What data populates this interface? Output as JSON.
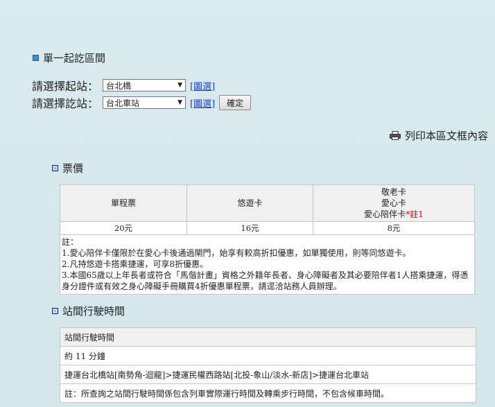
{
  "section1": {
    "title": "單一起訖區間"
  },
  "form": {
    "start_label": "請選擇起站：",
    "start_value": "台北橋",
    "end_label": "請選擇訖站：",
    "end_value": "台北車站",
    "map_select_label": "[圖選]",
    "confirm_label": "確定"
  },
  "print_label": "列印本區文框內容",
  "fare": {
    "title": "票價",
    "headers": {
      "single": "單程票",
      "easycard": "悠遊卡",
      "senior_1": "敬老卡",
      "senior_2": "愛心卡",
      "senior_3": "愛心陪伴卡",
      "senior_note": "*註1"
    },
    "values": {
      "single": "20元",
      "easycard": "16元",
      "senior": "8元"
    },
    "notes": [
      "註：",
      "1.愛心陪伴卡僅限於在愛心卡後通過閘門，始享有較高折扣優惠，如單獨使用，則等同悠遊卡。",
      "2.凡持悠遊卡搭乘捷運，可享8折優惠。",
      "3.本國65歲以上年長者或符合「馬偕計畫」資格之外籍年長者、身心障礙者及其必要陪伴者1人搭乘捷運，得憑身分證件或有效之身心障礙手冊購買4折優惠單程票，請逕洽站務人員辦理。"
    ]
  },
  "travel": {
    "title": "站間行駛時間",
    "header": "站間行駛時間",
    "duration": "約 11 分鐘",
    "route": "捷運台北橋站[南勢角-迴龍]>捷運民權西路站[北投-象山/淡水-新店]>捷運台北車站",
    "note": "註：所查詢之站間行駛時間係包含列車實際運行時間及轉乘步行時間，不包含候車時間。"
  }
}
